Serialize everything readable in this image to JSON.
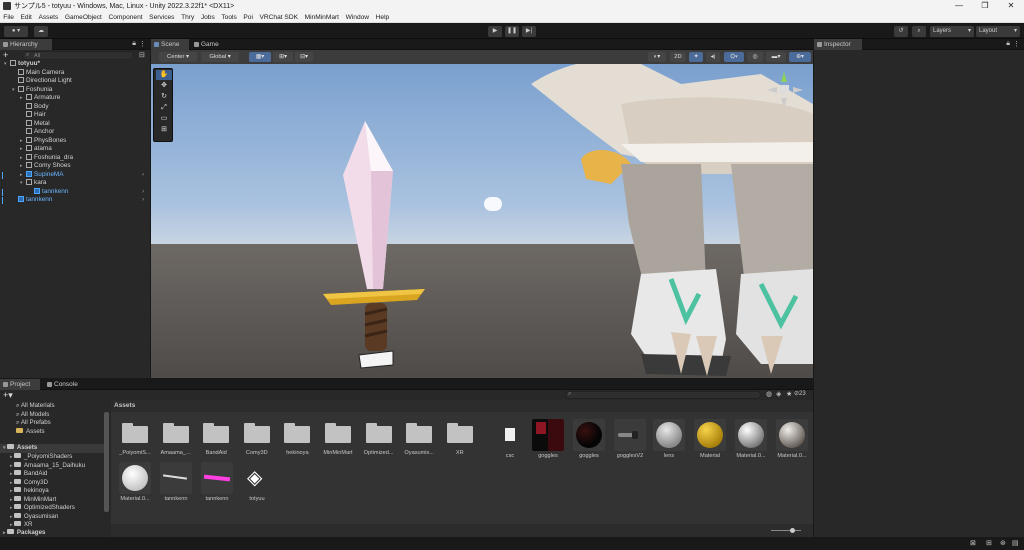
{
  "window": {
    "title": "サンプル5 - totyuu - Windows, Mac, Linux - Unity 2022.3.22f1* <DX11>",
    "controls": [
      "—",
      "❐",
      "✕"
    ]
  },
  "menu": [
    "File",
    "Edit",
    "Assets",
    "GameObject",
    "Component",
    "Services",
    "Thry",
    "Jobs",
    "Tools",
    "Poi",
    "VRChat SDK",
    "MinMinMart",
    "Window",
    "Help"
  ],
  "toolbar": {
    "account_label": "▾",
    "layers_label": "Layers",
    "layout_label": "Layout"
  },
  "hierarchy": {
    "tab_label": "Hierarchy",
    "search_placeholder": "All",
    "items": [
      {
        "label": "totyuu*",
        "depth": 0,
        "expanded": true,
        "scene": true
      },
      {
        "label": "Main Camera",
        "depth": 1
      },
      {
        "label": "Directional Light",
        "depth": 1
      },
      {
        "label": "Foshunia",
        "depth": 1,
        "expanded": true
      },
      {
        "label": "Armature",
        "depth": 2,
        "collapsed": true
      },
      {
        "label": "Body",
        "depth": 2
      },
      {
        "label": "Hair",
        "depth": 2
      },
      {
        "label": "Metal",
        "depth": 2
      },
      {
        "label": "Anchor",
        "depth": 2
      },
      {
        "label": "PhysBones",
        "depth": 2,
        "collapsed": true
      },
      {
        "label": "atama",
        "depth": 2,
        "collapsed": true
      },
      {
        "label": "Foshunia_dra",
        "depth": 2,
        "collapsed": true
      },
      {
        "label": "Comy Shoes",
        "depth": 2,
        "collapsed": true
      },
      {
        "label": "SupineMA",
        "depth": 2,
        "collapsed": true,
        "prefab": true
      },
      {
        "label": "kara",
        "depth": 2,
        "expanded": true
      },
      {
        "label": "tannkenn",
        "depth": 3,
        "prefab": true
      },
      {
        "label": "tannkenn",
        "depth": 1,
        "prefab": true
      }
    ]
  },
  "scene": {
    "tabs": [
      "Scene",
      "Game"
    ],
    "shading_center": "Center",
    "shading_global": "Global",
    "mode_2d": "2D"
  },
  "inspector": {
    "tab_label": "Inspector"
  },
  "project": {
    "tabs": [
      "Project",
      "Console"
    ],
    "favorites": [
      "All Materials",
      "All Models",
      "All Prefabs",
      "Assets"
    ],
    "tree_root": "Assets",
    "tree": [
      "_PoiyomiShaders",
      "Amaama_15_Daihuku",
      "BandAid",
      "Comy3D",
      "hekinoya",
      "MinMinMart",
      "OptimizedShaders",
      "Oyasumisan",
      "XR"
    ],
    "packages": "Packages",
    "breadcrumb": "Assets",
    "hidden_count": "23",
    "folders": [
      "_PoiyomiS...",
      "Amaama_...",
      "BandAid",
      "Comy3D",
      "hekinoya",
      "MinMinMart",
      "Optimized...",
      "Oyasumis...",
      "XR"
    ],
    "files": [
      {
        "label": "csc",
        "kind": "text"
      },
      {
        "label": "goggles",
        "kind": "texture"
      },
      {
        "label": "goggles",
        "kind": "mat-dark"
      },
      {
        "label": "gogglesV2",
        "kind": "mesh"
      },
      {
        "label": "lens",
        "kind": "mat-glass"
      },
      {
        "label": "Material",
        "kind": "mat-yellow"
      },
      {
        "label": "Material.0...",
        "kind": "mat-white"
      },
      {
        "label": "Material.0...",
        "kind": "mat-grey"
      },
      {
        "label": "Material.0...",
        "kind": "mat-white2"
      },
      {
        "label": "tannkenn",
        "kind": "mesh2"
      },
      {
        "label": "tannkenn",
        "kind": "prefab-pink"
      },
      {
        "label": "totyuu",
        "kind": "unity"
      }
    ]
  },
  "colors": {
    "accent": "#4fa4ff",
    "sky": "#7fa3cf",
    "ground": "#5a5550",
    "blade": "#f1d6e6",
    "guard": "#d9a521"
  }
}
